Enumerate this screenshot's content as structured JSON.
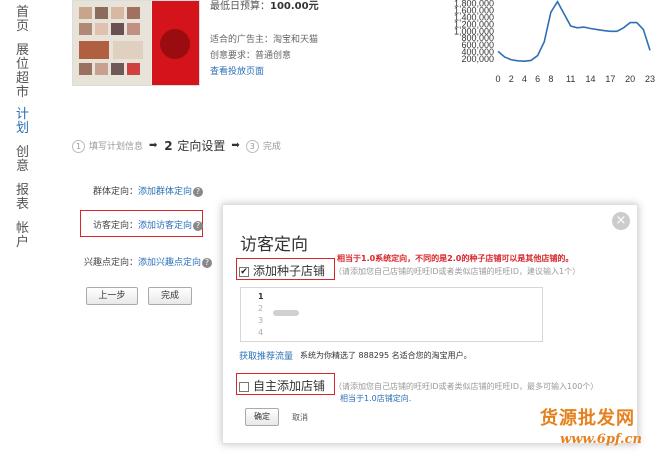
{
  "nav": {
    "items": [
      {
        "label": "首页",
        "active": false
      },
      {
        "label": "展位超市",
        "active": false
      },
      {
        "label": "计划",
        "active": true
      },
      {
        "label": "创意",
        "active": false
      },
      {
        "label": "报表",
        "active": false
      },
      {
        "label": "帐户",
        "active": false
      }
    ]
  },
  "ad": {
    "budget_label": "最低日预算：",
    "budget_value": "100.00元",
    "advertiser": "适合的广告主：淘宝和天猫",
    "creative_req": "创意要求：普通创意",
    "view_page_link": "查看投放页面"
  },
  "chart_data": {
    "type": "line",
    "x": [
      0,
      1,
      2,
      3,
      4,
      5,
      6,
      7,
      8,
      9,
      10,
      11,
      12,
      13,
      14,
      15,
      16,
      17,
      18,
      19,
      20,
      21,
      22,
      23
    ],
    "values": [
      420000,
      260000,
      180000,
      150000,
      140000,
      160000,
      300000,
      700000,
      1550000,
      1850000,
      1500000,
      1150000,
      1100000,
      1120000,
      1080000,
      1050000,
      1020000,
      1000000,
      1000000,
      1100000,
      1250000,
      1250000,
      1050000,
      450000
    ],
    "xticks": [
      "0",
      "2",
      "4",
      "6",
      "8",
      "11",
      "14",
      "17",
      "20",
      "23"
    ],
    "yticks": [
      "200,000",
      "400,000",
      "600,000",
      "800,000",
      "1,000,000",
      "1,200,000",
      "1,400,000",
      "1,600,000",
      "1,800,000"
    ],
    "ylim": [
      0,
      1900000
    ],
    "color": "#2f6fb6"
  },
  "steps": [
    {
      "num": "1",
      "label": "填写计划信息",
      "active": false
    },
    {
      "num": "2",
      "label": "定向设置",
      "active": true
    },
    {
      "num": "3",
      "label": "完成",
      "active": false
    }
  ],
  "targeting": {
    "group_label": "群体定向：",
    "group_link": "添加群体定向",
    "visitor_label": "访客定向：",
    "visitor_link": "添加访客定向",
    "interest_label": "兴趣点定向：",
    "interest_link": "添加兴趣点定向",
    "help": "?",
    "prev_button": "上一步",
    "finish_button": "完成"
  },
  "dialog": {
    "title": "访客定向",
    "close": "×",
    "note1": "相当于1.0系统定向，不同的是2.0的种子店铺可以是其他店铺的。",
    "option1": "添加种子店铺",
    "option1_checked": true,
    "option1_hint": "（请添加您自己店铺的旺旺ID或者类似店铺的旺旺ID，建议输入1个）",
    "lines": [
      "1",
      "2",
      "3",
      "4"
    ],
    "recommend_link": "获取推荐流量",
    "recommend_text": "系统为你精选了 888295 名适合您的淘宝用户。",
    "option2": "自主添加店铺",
    "option2_checked": false,
    "option2_hint": "（请添加您自己店铺的旺旺ID或者类似店铺的旺旺ID，最多可输入100个）",
    "note2": "相当于1.0店铺定向.",
    "confirm_button": "确定",
    "cancel_link": "取消"
  },
  "watermark": {
    "line1": "货源批发网",
    "line2": "www.6pf.cn"
  }
}
